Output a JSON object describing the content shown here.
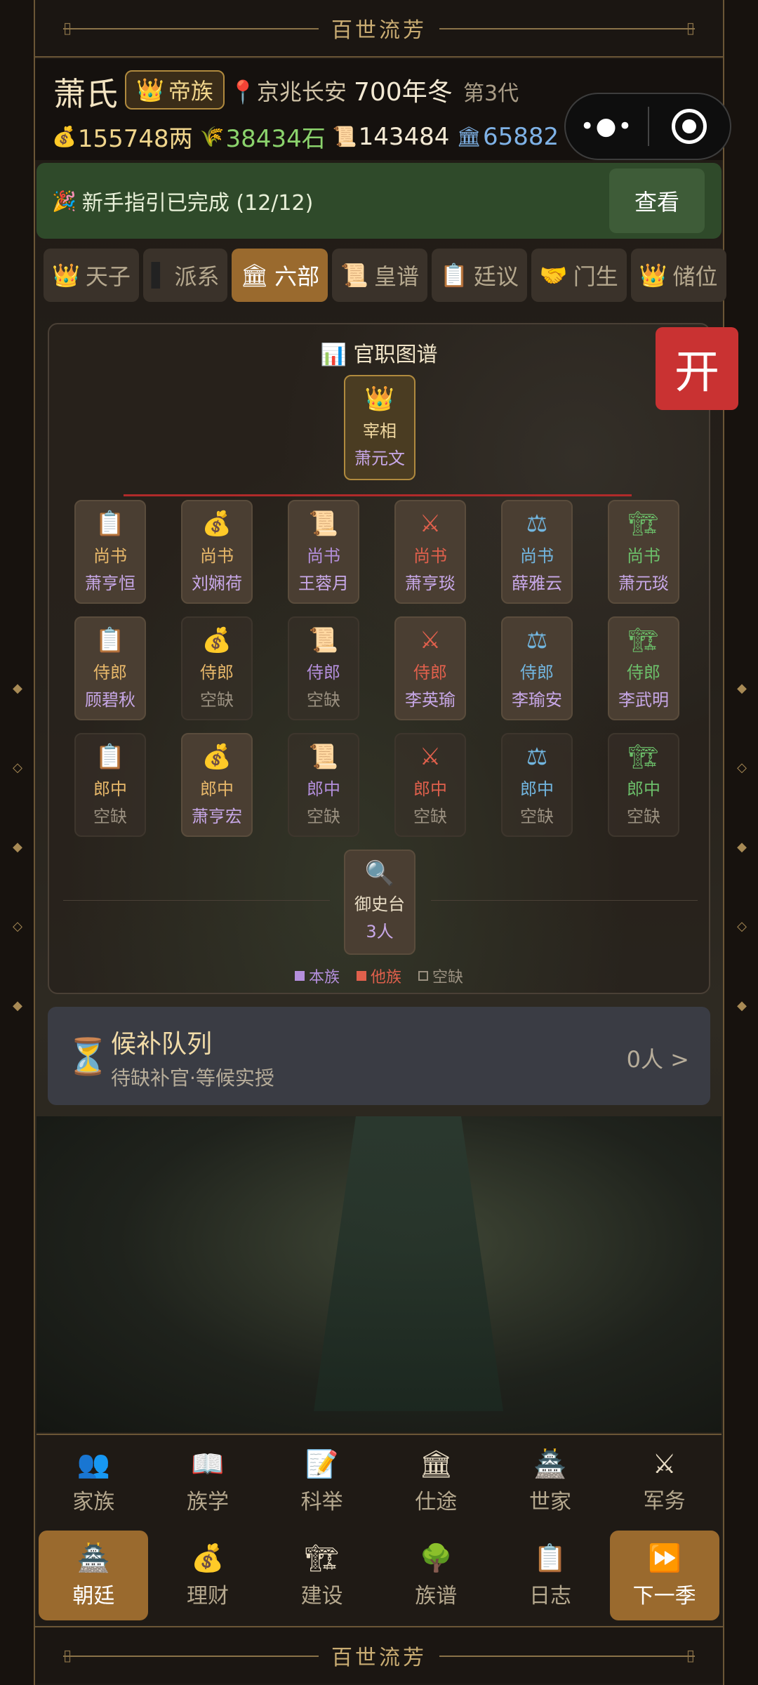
{
  "banner": {
    "title": "百世流芳"
  },
  "header": {
    "clan_name": "萧氏",
    "rank_icon": "crown-icon",
    "rank_label": "帝族",
    "location": "京兆长安",
    "year": "700年冬",
    "generation": "第3代",
    "resources": {
      "money": "155748两",
      "grain": "38434石",
      "cloth": "143484",
      "prestige": "65882"
    }
  },
  "guide": {
    "text": "新手指引已完成 (12/12)",
    "button": "查看"
  },
  "tabs": [
    {
      "label": "天子",
      "icon": "crown-icon"
    },
    {
      "label": "派系",
      "icon": "flag-icon"
    },
    {
      "label": "六部",
      "icon": "building-icon"
    },
    {
      "label": "皇谱",
      "icon": "scroll-icon"
    },
    {
      "label": "廷议",
      "icon": "clipboard-icon"
    },
    {
      "label": "门生",
      "icon": "handshake-icon"
    },
    {
      "label": "储位",
      "icon": "crown-icon"
    }
  ],
  "org": {
    "title": "官职图谱",
    "chief": {
      "position": "宰相",
      "name": "萧元文"
    },
    "departments": [
      {
        "icon": "📋",
        "color": "#e8b86a",
        "rows": [
          {
            "pos": "尚书",
            "name": "萧亨恒",
            "own": true
          },
          {
            "pos": "侍郎",
            "name": "顾碧秋",
            "own": true
          },
          {
            "pos": "郎中",
            "name": "空缺",
            "own": false
          }
        ]
      },
      {
        "icon": "💰",
        "color": "#e8b86a",
        "rows": [
          {
            "pos": "尚书",
            "name": "刘娴荷",
            "own": true
          },
          {
            "pos": "侍郎",
            "name": "空缺",
            "own": false
          },
          {
            "pos": "郎中",
            "name": "萧亨宏",
            "own": true
          }
        ]
      },
      {
        "icon": "📜",
        "color": "#b48fdc",
        "rows": [
          {
            "pos": "尚书",
            "name": "王蓉月",
            "own": true
          },
          {
            "pos": "侍郎",
            "name": "空缺",
            "own": false
          },
          {
            "pos": "郎中",
            "name": "空缺",
            "own": false
          }
        ]
      },
      {
        "icon": "⚔",
        "color": "#e0604c",
        "rows": [
          {
            "pos": "尚书",
            "name": "萧亨琰",
            "own": true
          },
          {
            "pos": "侍郎",
            "name": "李英瑜",
            "own": true
          },
          {
            "pos": "郎中",
            "name": "空缺",
            "own": false
          }
        ]
      },
      {
        "icon": "⚖",
        "color": "#72b6e0",
        "rows": [
          {
            "pos": "尚书",
            "name": "薛雅云",
            "own": true
          },
          {
            "pos": "侍郎",
            "name": "李瑜安",
            "own": true
          },
          {
            "pos": "郎中",
            "name": "空缺",
            "own": false
          }
        ]
      },
      {
        "icon": "🏗",
        "color": "#6cbf6a",
        "rows": [
          {
            "pos": "尚书",
            "name": "萧元琰",
            "own": true
          },
          {
            "pos": "侍郎",
            "name": "李武明",
            "own": true
          },
          {
            "pos": "郎中",
            "name": "空缺",
            "own": false
          }
        ]
      }
    ],
    "censor": {
      "name": "御史台",
      "count": "3人"
    },
    "legend": [
      {
        "label": "本族",
        "color": "#b48fdc"
      },
      {
        "label": "他族",
        "color": "#e0604c"
      },
      {
        "label": "空缺",
        "color": "#9a9080"
      }
    ]
  },
  "open_button": "开",
  "queue": {
    "title": "候补队列",
    "subtitle": "待缺补官·等候实授",
    "count": "0人 >"
  },
  "nav": {
    "row1": [
      {
        "label": "家族",
        "icon": "👥"
      },
      {
        "label": "族学",
        "icon": "📖"
      },
      {
        "label": "科举",
        "icon": "📝"
      },
      {
        "label": "仕途",
        "icon": "🏛"
      },
      {
        "label": "世家",
        "icon": "🏯"
      },
      {
        "label": "军务",
        "icon": "⚔"
      }
    ],
    "row2": [
      {
        "label": "朝廷",
        "icon": "🏯",
        "active": true
      },
      {
        "label": "理财",
        "icon": "💰"
      },
      {
        "label": "建设",
        "icon": "🏗"
      },
      {
        "label": "族谱",
        "icon": "🌳"
      },
      {
        "label": "日志",
        "icon": "📋"
      },
      {
        "label": "下一季",
        "icon": "⏩",
        "next": true
      }
    ]
  },
  "colors": {
    "accent": "#9a6a2e",
    "guide_bg": "#2f4a2a",
    "open_btn": "#c93232"
  }
}
